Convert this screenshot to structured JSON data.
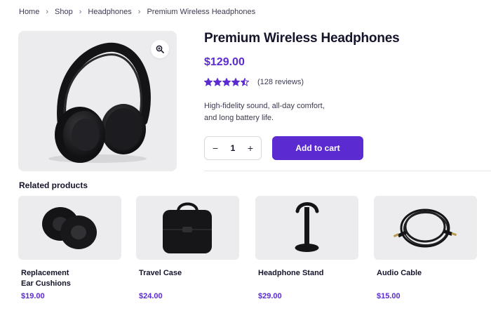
{
  "breadcrumb": {
    "items": [
      "Home",
      "Shop",
      "Headphones",
      "Premium Wireless Headphones"
    ],
    "separator": "›"
  },
  "product": {
    "title": "Premium Wireless Headphones",
    "price": "$129.00",
    "rating_value": 4.5,
    "rating_max": 5,
    "reviews": "(128 reviews)",
    "description_line1": "High-fidelity sound, all-day comfort,",
    "description_line2": "and long battery life.",
    "quantity": "1",
    "decrement": "−",
    "increment": "+",
    "add_to_cart": "Add to cart",
    "image_icon": "headphones-image",
    "zoom_icon": "zoom-in-icon"
  },
  "related": {
    "title": "Related products",
    "items": [
      {
        "name_line1": "Replacement",
        "name_line2": "Ear Cushions",
        "price": "$19.00",
        "icon": "ear-cushions-image"
      },
      {
        "name_line1": "Travel Case",
        "name_line2": "",
        "price": "$24.00",
        "icon": "travel-case-image"
      },
      {
        "name_line1": "Headphone Stand",
        "name_line2": "",
        "price": "$29.00",
        "icon": "headphone-stand-image"
      },
      {
        "name_line1": "Audio Cable",
        "name_line2": "",
        "price": "$15.00",
        "icon": "audio-cable-image"
      }
    ]
  },
  "colors": {
    "accent": "#5b2bd1",
    "text": "#14142b",
    "image_bg": "#ececee"
  }
}
